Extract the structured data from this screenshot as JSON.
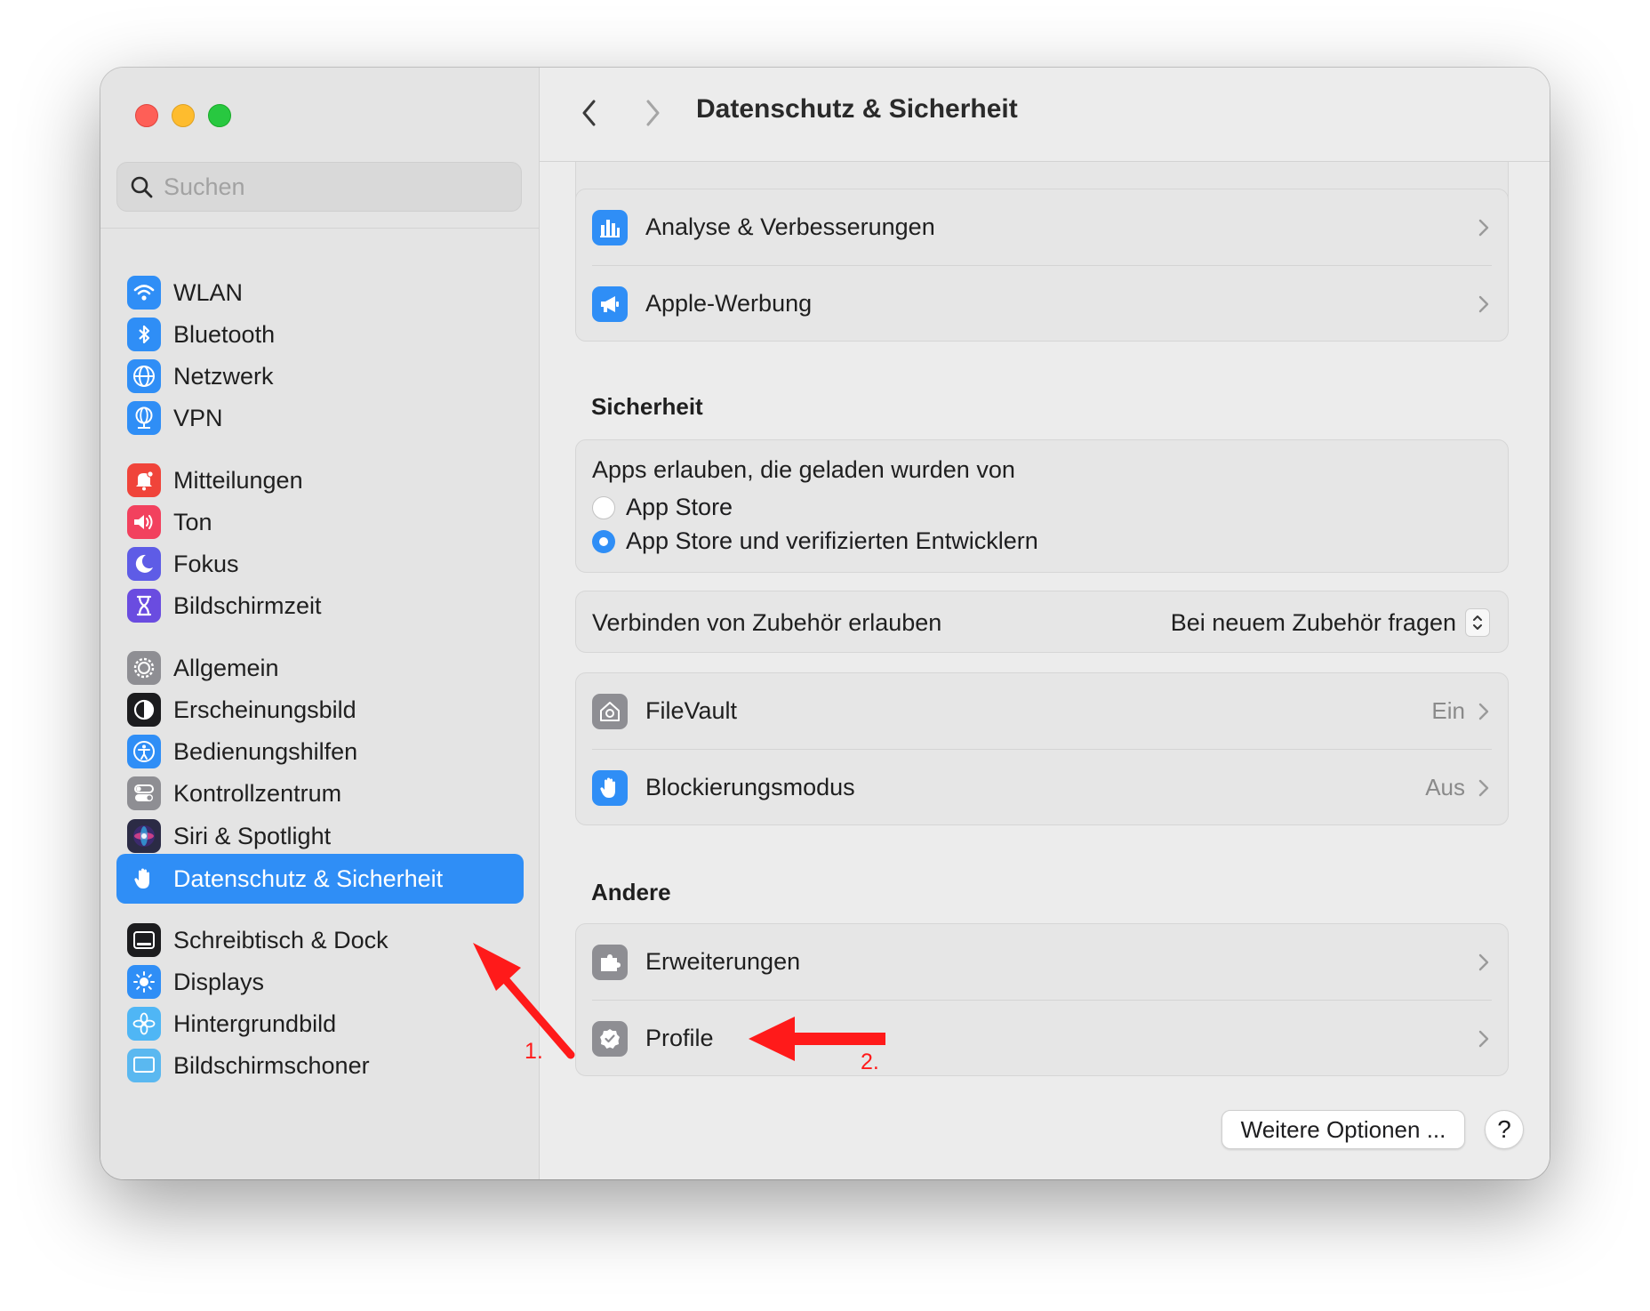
{
  "window": {
    "title": "Datenschutz & Sicherheit"
  },
  "search": {
    "placeholder": "Suchen"
  },
  "sidebar": {
    "items": [
      {
        "label": "WLAN",
        "icon": "wifi-icon",
        "color": "#2f8ef6"
      },
      {
        "label": "Bluetooth",
        "icon": "bluetooth-icon",
        "color": "#2f8ef6"
      },
      {
        "label": "Netzwerk",
        "icon": "globe-icon",
        "color": "#2f8ef6"
      },
      {
        "label": "VPN",
        "icon": "vpn-globe-icon",
        "color": "#2f8ef6"
      },
      {
        "label": "Mitteilungen",
        "icon": "bell-icon",
        "color": "#f0443a"
      },
      {
        "label": "Ton",
        "icon": "speaker-icon",
        "color": "#f2415e"
      },
      {
        "label": "Fokus",
        "icon": "moon-icon",
        "color": "#5e5ce6"
      },
      {
        "label": "Bildschirmzeit",
        "icon": "hourglass-icon",
        "color": "#6a4ce0"
      },
      {
        "label": "Allgemein",
        "icon": "gear-icon",
        "color": "#8e8e93"
      },
      {
        "label": "Erscheinungsbild",
        "icon": "appearance-icon",
        "color": "#1c1c1e"
      },
      {
        "label": "Bedienungshilfen",
        "icon": "accessibility-icon",
        "color": "#2f8ef6"
      },
      {
        "label": "Kontrollzentrum",
        "icon": "toggles-icon",
        "color": "#8e8e93"
      },
      {
        "label": "Siri & Spotlight",
        "icon": "siri-icon",
        "color": "#2b2b45"
      },
      {
        "label": "Datenschutz & Sicherheit",
        "icon": "hand-icon",
        "color": "#2f8ef6",
        "active": true
      },
      {
        "label": "Schreibtisch & Dock",
        "icon": "dock-icon",
        "color": "#1c1c1e"
      },
      {
        "label": "Displays",
        "icon": "sun-icon",
        "color": "#2f8ef6"
      },
      {
        "label": "Hintergrundbild",
        "icon": "flower-icon",
        "color": "#4fb6f5"
      },
      {
        "label": "Bildschirmschoner",
        "icon": "screensaver-icon",
        "color": "#5ab8f0"
      }
    ]
  },
  "privacy_rows": [
    {
      "label": "Analyse & Verbesserungen",
      "icon": "chart-icon",
      "color": "#2f8ef6"
    },
    {
      "label": "Apple-Werbung",
      "icon": "megaphone-icon",
      "color": "#2f8ef6"
    }
  ],
  "security": {
    "title": "Sicherheit",
    "apps_allowed_label": "Apps erlauben, die geladen wurden von",
    "options": [
      {
        "label": "App Store",
        "selected": false
      },
      {
        "label": "App Store und verifizierten Entwicklern",
        "selected": true
      }
    ],
    "accessory_label": "Verbinden von Zubehör erlauben",
    "accessory_value": "Bei neuem Zubehör fragen",
    "filevault": {
      "label": "FileVault",
      "value": "Ein",
      "color": "#8e8e93"
    },
    "lockdown": {
      "label": "Blockierungsmodus",
      "value": "Aus",
      "color": "#2f8ef6"
    }
  },
  "other": {
    "title": "Andere",
    "rows": [
      {
        "label": "Erweiterungen",
        "icon": "puzzle-icon",
        "color": "#8e8e93"
      },
      {
        "label": "Profile",
        "icon": "badge-check-icon",
        "color": "#8e8e93"
      }
    ]
  },
  "footer": {
    "more_options": "Weitere Optionen ...",
    "help": "?"
  },
  "annotations": {
    "step1": "1.",
    "step2": "2.",
    "arrow_color": "#ff1a1a"
  }
}
